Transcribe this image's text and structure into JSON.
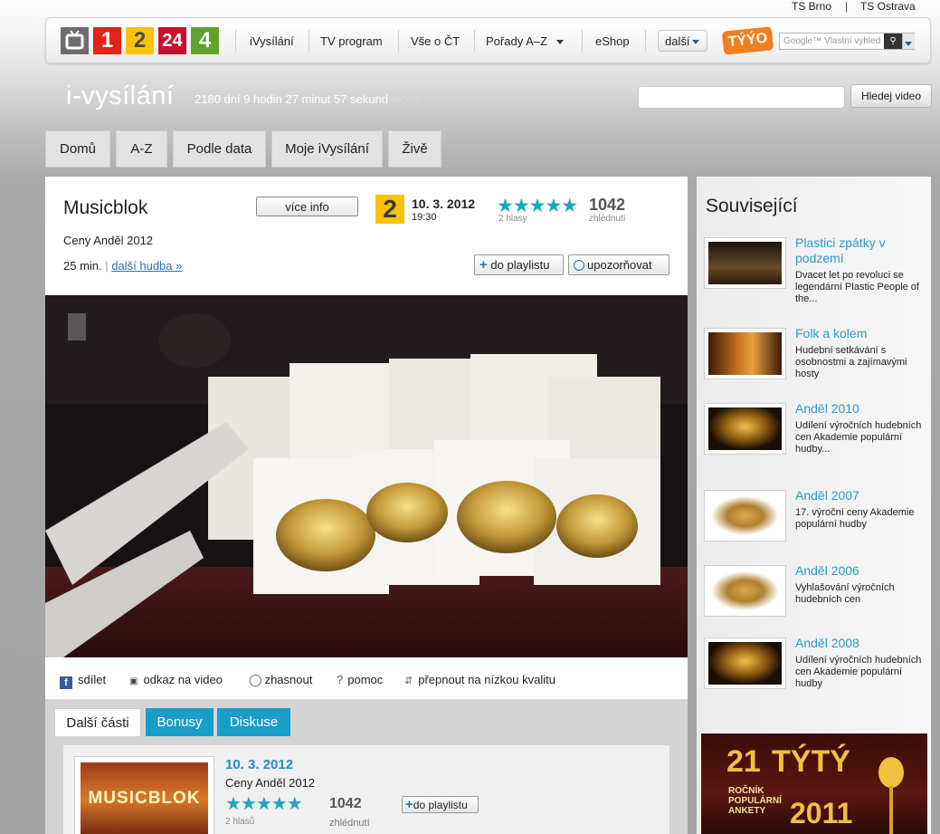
{
  "regions": {
    "brno": "TS Brno",
    "sep": "|",
    "ostrava": "TS Ostrava"
  },
  "topbar": {
    "channels": [
      {
        "label": "",
        "color": "#6d6d6d"
      },
      {
        "label": "1",
        "color": "#e2231a"
      },
      {
        "label": "2",
        "color": "#f8c300"
      },
      {
        "label": "24",
        "color": "#c8102e"
      },
      {
        "label": "4",
        "color": "#5fa32a"
      }
    ],
    "nav": [
      "iVysílání",
      "TV program",
      "Vše o ČT",
      "Pořady A–Z",
      "eShop"
    ],
    "more": "další",
    "tyyo_logo": "TÝÝO",
    "google_placeholder": "Google™ Vlastní vyhled"
  },
  "header": {
    "logo": "i-vysílání",
    "stats": "2180 dní 9 hodin 27 minut 57 sekund",
    "stats_suffix": "videa",
    "search_button": "Hledej video"
  },
  "tabs": [
    "Domů",
    "A-Z",
    "Podle data",
    "Moje iVysílání",
    "Živě"
  ],
  "program": {
    "title": "Musicblok",
    "subtitle": "Ceny Anděl 2012",
    "duration": "25 min.",
    "sep": "|",
    "more_music": "další hudba »",
    "more_info": "více info",
    "channel_badge": "2",
    "date": "10. 3. 2012",
    "time": "19:30",
    "stars": "★★★★★",
    "votes": "2 hlasy",
    "views": "1042",
    "views_label": "zhlédnutí",
    "add_playlist": "do playlistu",
    "notify": "upozorňovat"
  },
  "video_tools": {
    "share": "sdílet",
    "link": "odkaz na video",
    "dim": "zhasnout",
    "help": "pomoc",
    "quality": "přepnout na nízkou kvalitu"
  },
  "lower_tabs": [
    "Další části",
    "Bonusy",
    "Diskuse"
  ],
  "episode": {
    "thumb_text": "MUSICBLOK",
    "date": "10. 3. 2012",
    "subtitle": "Ceny Anděl 2012",
    "stars": "★★★★★",
    "votes": "2 hlasů",
    "views": "1042",
    "views_label": "zhlédnutí",
    "add_playlist": "do playlistu"
  },
  "sidebar": {
    "title": "Související",
    "items": [
      {
        "title": "Plastici zpátky v podzemí",
        "desc": "Dvacet let po revoluci se legendární Plastic People of the..."
      },
      {
        "title": "Folk a kolem",
        "desc": "Hudební setkávání s osobnostmi a zajímavými hosty"
      },
      {
        "title": "Anděl 2010",
        "desc": "Udílení výročních hudebních cen Akademie populární hudby..."
      },
      {
        "title": "Anděl 2007",
        "desc": "17. výroční ceny Akademie populární hudby"
      },
      {
        "title": "Anděl 2006",
        "desc": "Vyhlašování výročních hudebních cen"
      },
      {
        "title": "Anděl 2008",
        "desc": "Udílení výročních hudebních cen Akademie populární hudby"
      }
    ],
    "promo": {
      "number": "21",
      "brand": "TÝTÝ",
      "line1": "ROČNÍK",
      "line2": "POPULÁRNÍ",
      "line3": "ANKETY",
      "year": "2011"
    }
  }
}
